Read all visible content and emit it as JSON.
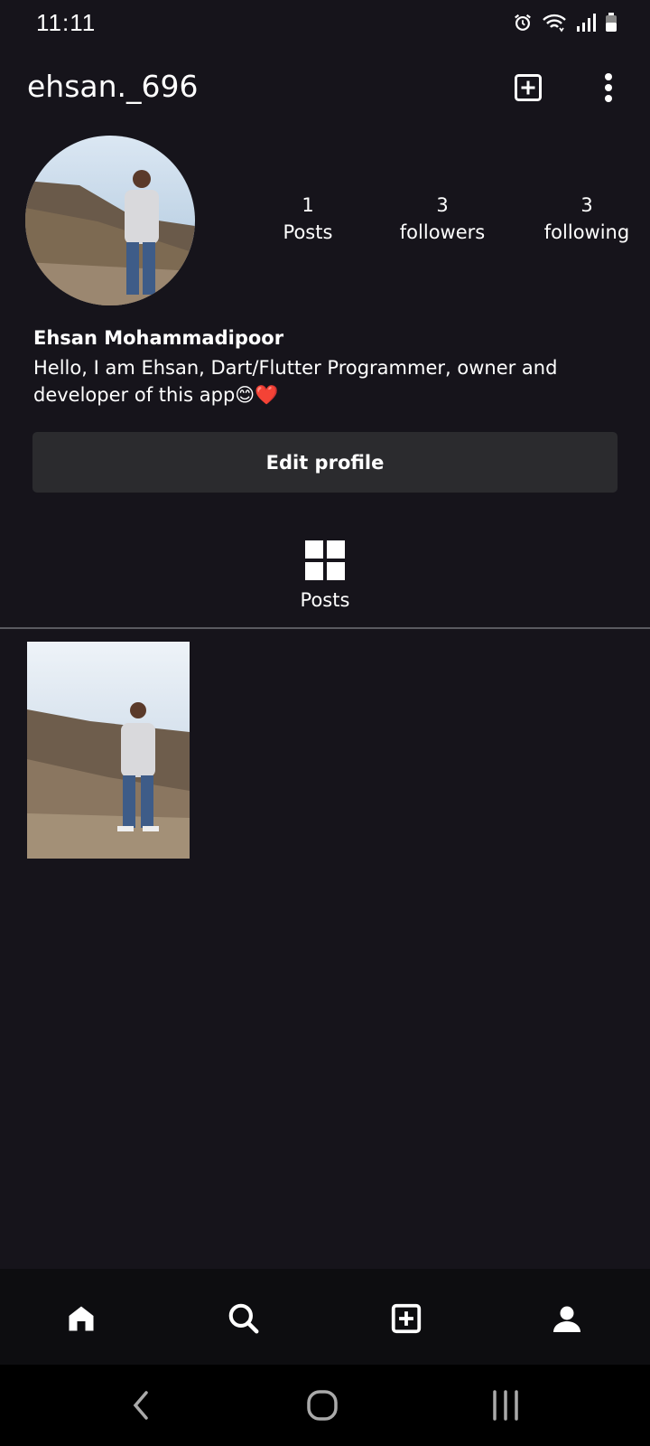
{
  "status": {
    "time": "11:11",
    "icons": [
      "alarm-icon",
      "wifi-icon",
      "signal-icon",
      "battery-icon"
    ]
  },
  "header": {
    "username": "ehsan._696",
    "add_icon": "add-box-icon",
    "more_icon": "more-vert-icon"
  },
  "profile": {
    "stats": [
      {
        "count": "1",
        "label": "Posts"
      },
      {
        "count": "3",
        "label": "followers"
      },
      {
        "count": "3",
        "label": "following"
      }
    ],
    "name": "Ehsan Mohammadipoor",
    "bio": "Hello, I am Ehsan, Dart/Flutter Programmer, owner and developer of this app😊❤️",
    "edit_button": "Edit profile"
  },
  "tabs": {
    "posts_label": "Posts",
    "posts_icon": "grid-icon"
  },
  "bottom_nav": [
    "home-icon",
    "search-icon",
    "add-box-icon",
    "person-icon"
  ],
  "system_nav": [
    "back-icon",
    "home-circle-icon",
    "recents-icon"
  ],
  "colors": {
    "background": "#16141b",
    "button": "#2b2b2e",
    "nav_bar": "#0d0d10"
  }
}
